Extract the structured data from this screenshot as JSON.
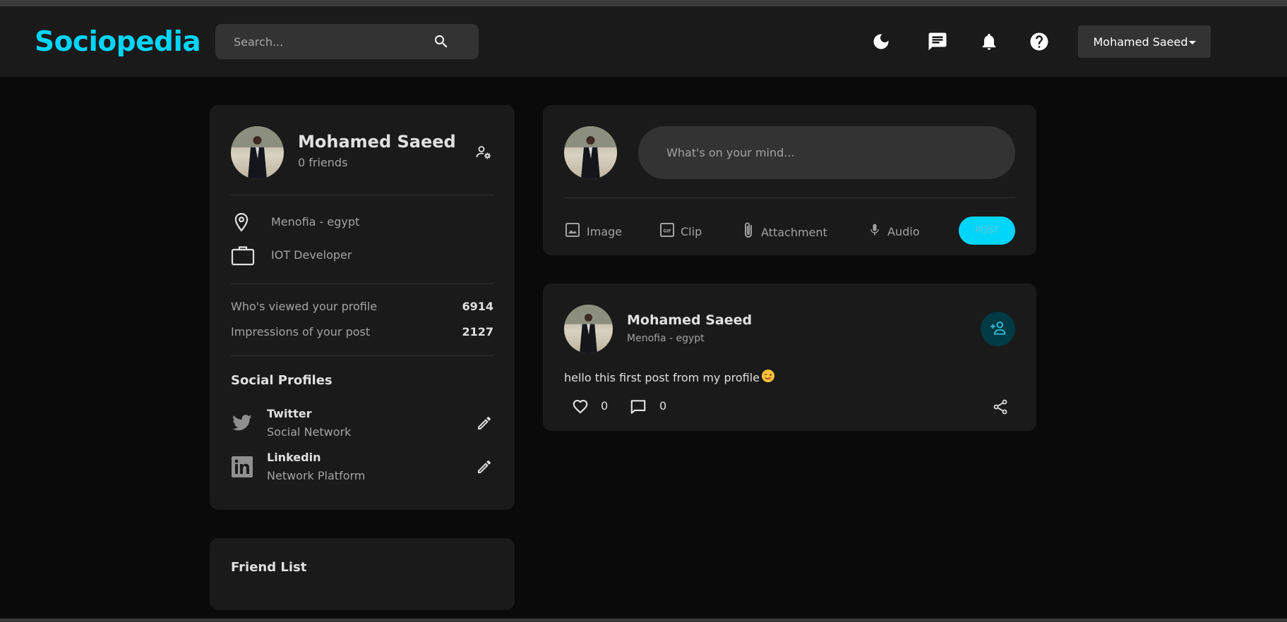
{
  "header": {
    "logo": "Sociopedia",
    "search_placeholder": "Search...",
    "user_name": "Mohamed Saeed",
    "icons": [
      "dark-mode-icon",
      "message-icon",
      "notifications-icon",
      "help-icon"
    ],
    "accent": "#00D5FA"
  },
  "profile": {
    "name": "Mohamed Saeed",
    "friends": "0 friends",
    "location": "Menofia - egypt",
    "occupation": "IOT Developer",
    "stats": [
      {
        "label": "Who's viewed your profile",
        "value": "6914"
      },
      {
        "label": "Impressions of your post",
        "value": "2127"
      }
    ],
    "social_title": "Social Profiles",
    "socials": [
      {
        "name": "Twitter",
        "desc": "Social Network",
        "icon": "twitter-icon"
      },
      {
        "name": "Linkedin",
        "desc": "Network Platform",
        "icon": "linkedin-icon"
      }
    ]
  },
  "friend_list": {
    "title": "Friend List"
  },
  "composer": {
    "placeholder": "What's on your mind...",
    "actions": {
      "image": "Image",
      "clip": "Clip",
      "attachment": "Attachment",
      "audio": "Audio"
    },
    "post_button": "POST"
  },
  "post": {
    "author": "Mohamed Saeed",
    "location": "Menofia - egypt",
    "text": "hello this first post from my profile",
    "likes": "0",
    "comments": "0"
  }
}
